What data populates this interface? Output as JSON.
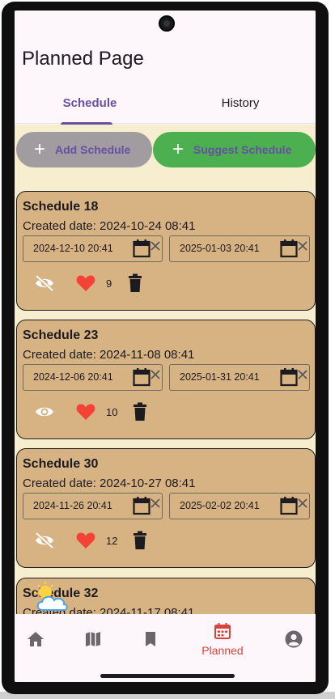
{
  "header": {
    "title": "Planned Page"
  },
  "tabs": [
    {
      "label": "Schedule",
      "active": true
    },
    {
      "label": "History",
      "active": false
    }
  ],
  "actions": {
    "add_label": "Add Schedule",
    "suggest_label": "Suggest Schedule"
  },
  "schedules": [
    {
      "title": "Schedule 18",
      "created": "Created date: 2024-10-24 08:41",
      "start": "2024-12-10 20:41",
      "end": "2025-01-03 20:41",
      "visibility_icon": "eye-off-icon",
      "likes": "9"
    },
    {
      "title": "Schedule 23",
      "created": "Created date: 2024-11-08 08:41",
      "start": "2024-12-06 20:41",
      "end": "2025-01-31 20:41",
      "visibility_icon": "eye-icon",
      "likes": "10"
    },
    {
      "title": "Schedule 30",
      "created": "Created date: 2024-10-27 08:41",
      "start": "2024-11-26 20:41",
      "end": "2025-02-02 20:41",
      "visibility_icon": "eye-off-icon",
      "likes": "12"
    },
    {
      "title": "Schedule 32",
      "created": "Created date: 2024-11-17 08:41"
    }
  ],
  "bottom_nav": {
    "items": [
      {
        "icon": "home-icon",
        "label": ""
      },
      {
        "icon": "map-icon",
        "label": ""
      },
      {
        "icon": "bookmark-icon",
        "label": ""
      },
      {
        "icon": "calendar-icon",
        "label": "Planned",
        "active": true
      },
      {
        "icon": "account-icon",
        "label": ""
      }
    ]
  },
  "colors": {
    "accent": "#6750a4",
    "card": "#d7b283",
    "suggest": "#4caf50",
    "active_nav": "#d9433a",
    "heart": "#f44336"
  }
}
